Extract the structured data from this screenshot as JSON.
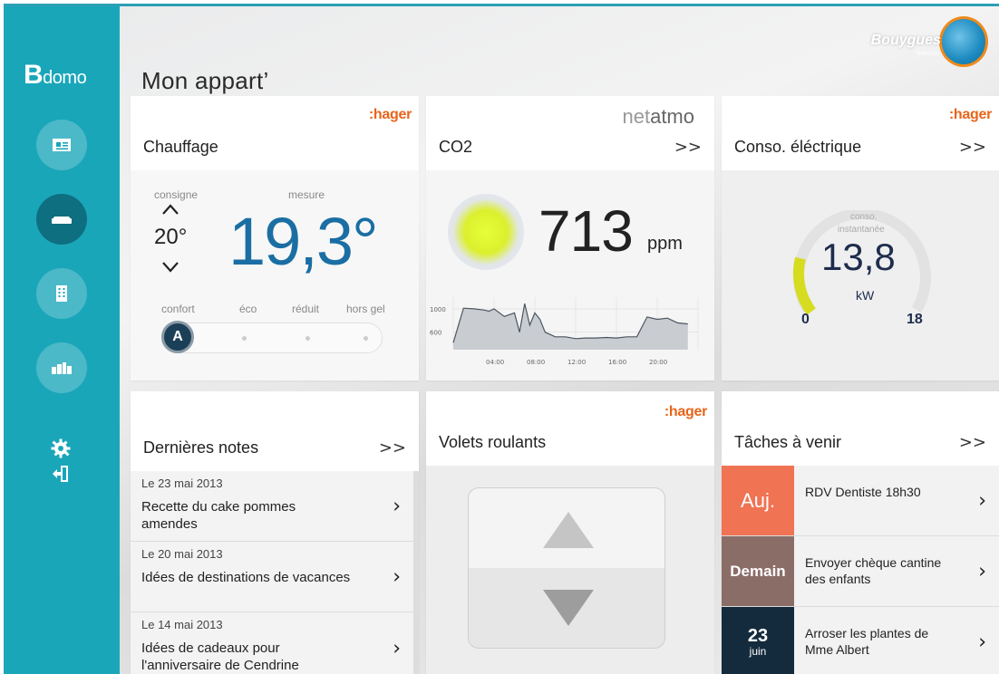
{
  "app": {
    "logo_big": "B",
    "logo_small": "domo",
    "title": "Mon appart’"
  },
  "brand": {
    "name": "Bouygues",
    "sub": "Telecom"
  },
  "colors": {
    "sidebar": "#1aa6b9",
    "accent_blue": "#1a6ea3",
    "hager": "#e8641b",
    "today": "#f07353",
    "tomorrow": "#8b6d68",
    "later": "#142b3d"
  },
  "nav": [
    {
      "icon": "news-icon",
      "active": false
    },
    {
      "icon": "sofa-icon",
      "active": true
    },
    {
      "icon": "building-icon",
      "active": false
    },
    {
      "icon": "neighborhood-icon",
      "active": false
    }
  ],
  "tools": [
    {
      "icon": "gear-icon"
    },
    {
      "icon": "logout-icon"
    }
  ],
  "heating": {
    "title": "Chauffage",
    "vendor": ":hager",
    "setpoint_label": "consigne",
    "measure_label": "mesure",
    "setpoint": "20°",
    "measure": "19,3°",
    "modes": [
      "confort",
      "éco",
      "réduit",
      "hors gel"
    ],
    "active_mode_badge": "A"
  },
  "co2": {
    "title": "CO2",
    "vendor_light": "net",
    "vendor_bold": "atmo",
    "more": ">>",
    "value": "713",
    "unit": "ppm",
    "chart_data": {
      "type": "area",
      "x": [
        "00:00",
        "01:00",
        "02:00",
        "03:00",
        "03:30",
        "04:00",
        "05:00",
        "06:00",
        "06:30",
        "07:00",
        "07:30",
        "08:00",
        "08:30",
        "09:00",
        "09:30",
        "10:00",
        "11:00",
        "12:00",
        "13:00",
        "14:00",
        "15:00",
        "16:00",
        "17:00",
        "18:00",
        "19:00",
        "20:00",
        "21:00",
        "22:00",
        "23:00"
      ],
      "values": [
        420,
        1010,
        1000,
        980,
        960,
        1000,
        870,
        930,
        600,
        1090,
        720,
        930,
        820,
        600,
        560,
        520,
        520,
        490,
        500,
        500,
        510,
        500,
        520,
        520,
        860,
        820,
        840,
        760,
        740
      ],
      "yticks": [
        "1000",
        "600"
      ],
      "xticks": [
        "04:00",
        "08:00",
        "12:00",
        "16:00",
        "20:00"
      ],
      "ylim": [
        300,
        1200
      ]
    }
  },
  "power": {
    "title": "Conso. éléctrique",
    "vendor": ":hager",
    "more": ">>",
    "label_line1": "conso.",
    "label_line2": "instantanée",
    "value": "13,8",
    "unit": "kW",
    "min": "0",
    "max": "18",
    "level_fraction": 0.2
  },
  "notes": {
    "title": "Dernières notes",
    "more": ">>",
    "items": [
      {
        "date": "Le 23 mai 2013",
        "text": "Recette du cake pommes amendes"
      },
      {
        "date": "Le 20 mai 2013",
        "text": "Idées de destinations de vacances"
      },
      {
        "date": "Le 14 mai 2013",
        "text": "Idées de cadeaux pour l'anniversaire de Cendrine"
      }
    ]
  },
  "shutters": {
    "title": "Volets roulants",
    "vendor": ":hager"
  },
  "tasks": {
    "title": "Tâches à venir",
    "more": ">>",
    "items": [
      {
        "day": "Auj.",
        "day_sub": "",
        "text": "RDV Dentiste 18h30",
        "color": "#f07353"
      },
      {
        "day": "Demain",
        "day_sub": "",
        "text": "Envoyer chèque cantine des enfants",
        "color": "#8b6d68"
      },
      {
        "day": "23",
        "day_sub": "juin",
        "text": "Arroser les plantes de Mme Albert",
        "color": "#142b3d"
      }
    ]
  }
}
